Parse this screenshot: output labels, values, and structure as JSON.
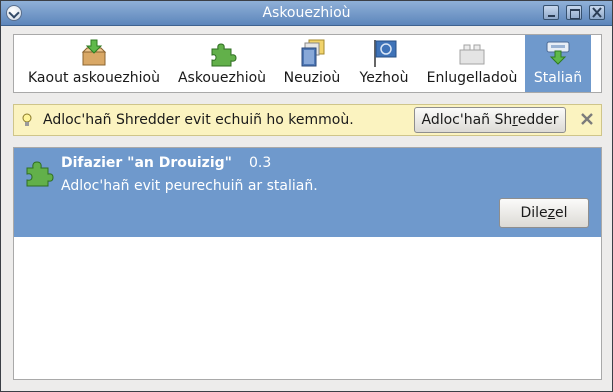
{
  "window": {
    "title": "Askouezhioù"
  },
  "toolbar": {
    "items": [
      {
        "label": "Kaout askouezhioù",
        "icon": "get-addons-box-icon"
      },
      {
        "label": "Askouezhioù",
        "icon": "puzzle-piece-icon"
      },
      {
        "label": "Neuzioù",
        "icon": "themes-icon"
      },
      {
        "label": "Yezhoù",
        "icon": "languages-flag-icon"
      },
      {
        "label": "Enlugelladoù",
        "icon": "plugins-block-icon"
      },
      {
        "label": "Staliañ",
        "icon": "install-icon",
        "selected": true
      }
    ]
  },
  "notification": {
    "icon": "lightbulb-icon",
    "message": "Adloc'hañ Shredder evit echuiñ ho kemmoù.",
    "button_pre": "Adloc'hañ Sh",
    "button_accel": "r",
    "button_post": "edder",
    "close_icon": "close-x-icon"
  },
  "install_list": {
    "items": [
      {
        "name": "Difazier \"an Drouizig\"",
        "version": "0.3",
        "description": "Adloc'hañ evit peurechuiñ ar staliañ.",
        "button_pre": "Dile",
        "button_accel": "z",
        "button_post": "el",
        "icon": "puzzle-piece-icon"
      }
    ]
  },
  "colors": {
    "selection": "#6f99cc",
    "notification_bg": "#fbf3c0",
    "titlebar": "#5d86bb"
  }
}
